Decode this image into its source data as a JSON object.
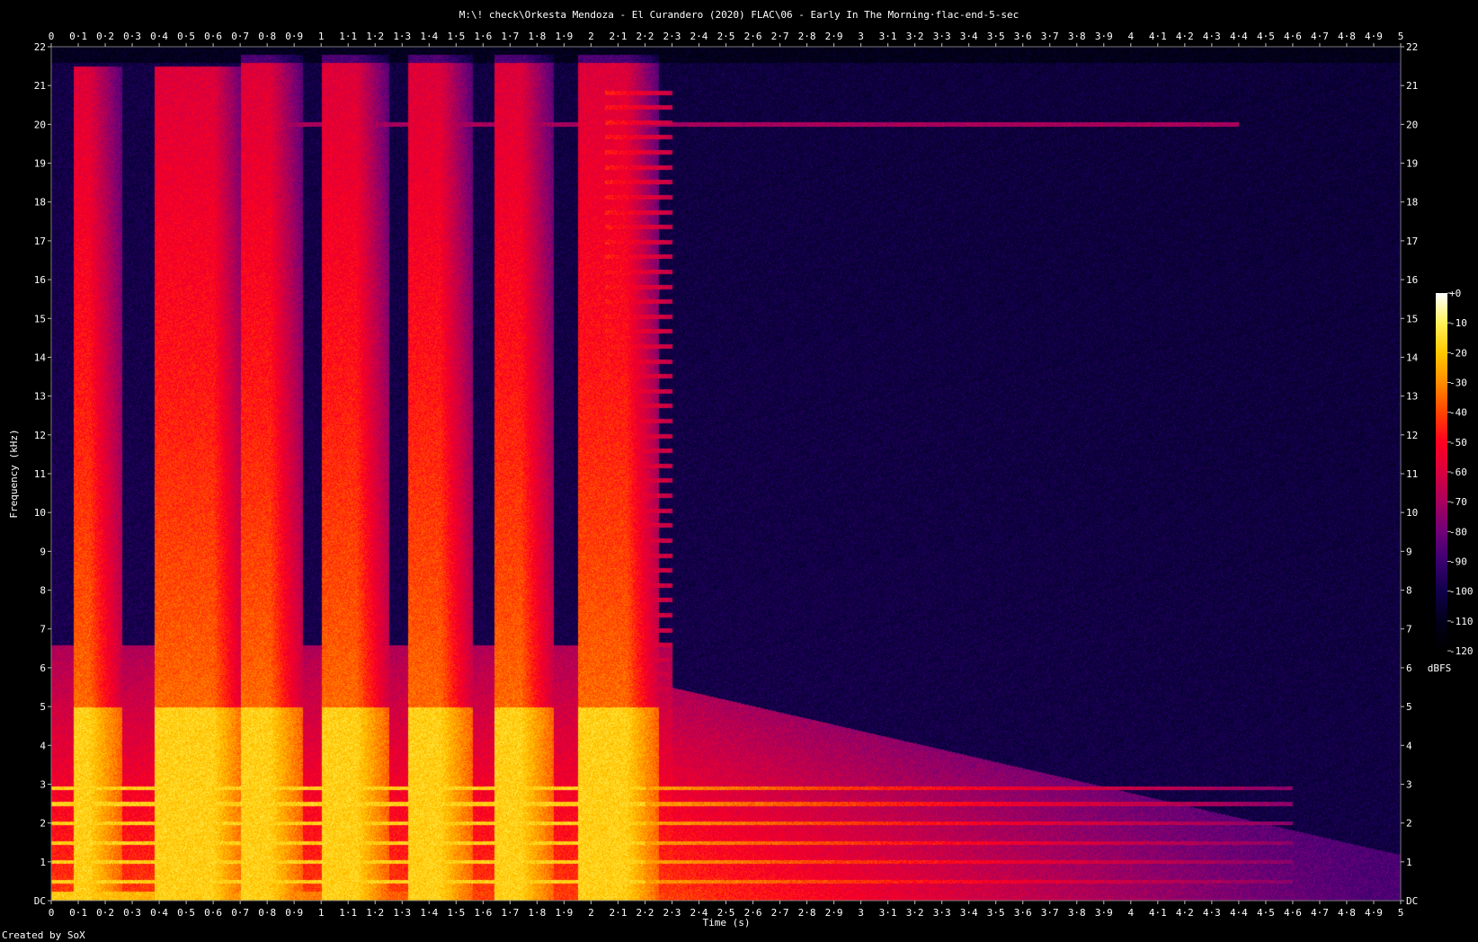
{
  "chart_data": {
    "type": "heatmap",
    "title": "M:\\! check\\Orkesta Mendoza - El Curandero (2020) FLAC\\06 - Early In The Morning·flac-end-5-sec",
    "xlabel": "Time (s)",
    "ylabel": "Frequency (kHz)",
    "xlim": [
      0,
      5
    ],
    "ylim": [
      0,
      22
    ],
    "x_ticks": [
      "0",
      "0·1",
      "0·2",
      "0·3",
      "0·4",
      "0·5",
      "0·6",
      "0·7",
      "0·8",
      "0·9",
      "1",
      "1·1",
      "1·2",
      "1·3",
      "1·4",
      "1·5",
      "1·6",
      "1·7",
      "1·8",
      "1·9",
      "2",
      "2·1",
      "2·2",
      "2·3",
      "2·4",
      "2·5",
      "2·6",
      "2·7",
      "2·8",
      "2·9",
      "3",
      "3·1",
      "3·2",
      "3·3",
      "3·4",
      "3·5",
      "3·6",
      "3·7",
      "3·8",
      "3·9",
      "4",
      "4·1",
      "4·2",
      "4·3",
      "4·4",
      "4·5",
      "4·6",
      "4·7",
      "4·8",
      "4·9",
      "5"
    ],
    "y_ticks": [
      "DC",
      "1",
      "2",
      "3",
      "4",
      "5",
      "6",
      "7",
      "8",
      "9",
      "10",
      "11",
      "12",
      "13",
      "14",
      "15",
      "16",
      "17",
      "18",
      "19",
      "20",
      "21",
      "22"
    ],
    "colorbar": {
      "label": "dBFS",
      "range": [
        -120,
        0
      ],
      "ticks": [
        "+0",
        "-10",
        "-20",
        "-30",
        "-40",
        "-50",
        "-60",
        "-70",
        "-80",
        "-90",
        "-100",
        "-110",
        "-120"
      ],
      "stops": [
        "#ffffff",
        "#fff25a",
        "#ffc800",
        "#ff8c00",
        "#ff4400",
        "#ff0020",
        "#d8003e",
        "#a8005c",
        "#700078",
        "#3a0070",
        "#10004a",
        "#02001a",
        "#000000"
      ]
    },
    "transients_s": [
      {
        "start": 0.08,
        "end": 0.14,
        "peak_khz": 21.5
      },
      {
        "start": 0.38,
        "end": 0.6,
        "peak_khz": 21.5
      },
      {
        "start": 0.7,
        "end": 0.81,
        "peak_khz": 21.8
      },
      {
        "start": 1.0,
        "end": 1.13,
        "peak_khz": 21.8
      },
      {
        "start": 1.32,
        "end": 1.44,
        "peak_khz": 21.8
      },
      {
        "start": 1.64,
        "end": 1.74,
        "peak_khz": 21.8
      },
      {
        "start": 1.95,
        "end": 2.13,
        "peak_khz": 21.8
      }
    ],
    "harmonic_comb": {
      "start": 2.05,
      "end": 2.3,
      "from_khz": 5,
      "to_khz": 21
    },
    "tone_lines_khz": [
      0.5,
      1.0,
      1.5,
      2.0,
      2.5,
      2.9
    ],
    "tone_lines_end_s": 4.6,
    "hf_line": {
      "khz": 20.0,
      "start": 0.85,
      "end": 4.4
    },
    "dc_rumble_end_s": 4.95
  },
  "footer": "Created by SoX"
}
